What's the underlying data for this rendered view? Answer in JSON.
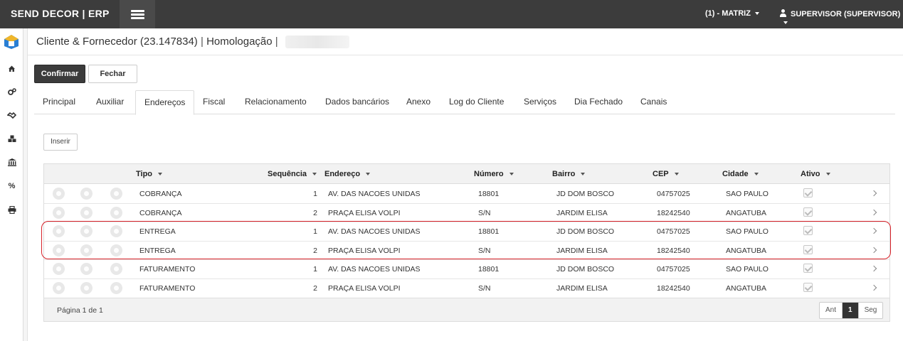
{
  "app": {
    "brand": "SEND DECOR | ERP",
    "branch": "(1) - MATRIZ",
    "user": "SUPERVISOR (SUPERVISOR)"
  },
  "colors": {
    "topbar": "#3c3c3c",
    "highlight": "#d8232a",
    "confirm_button": "#3b3b3b"
  },
  "sidebar": {
    "icons": [
      "home-icon",
      "cogs-icon",
      "handshake-icon",
      "cubes-icon",
      "bank-icon",
      "percent-icon",
      "print-icon"
    ]
  },
  "page": {
    "title": "Cliente & Fornecedor (23.147834)",
    "sep1": "|",
    "env": "Homologação",
    "sep2": "|"
  },
  "actions": {
    "confirm": "Confirmar",
    "close": "Fechar",
    "insert": "Inserir"
  },
  "tabs": [
    "Principal",
    "Auxiliar",
    "Endereços",
    "Fiscal",
    "Relacionamento",
    "Dados bancários",
    "Anexo",
    "Log do Cliente",
    "Serviços",
    "Dia Fechado",
    "Canais"
  ],
  "active_tab": "Endereços",
  "table": {
    "columns": {
      "tipo": "Tipo",
      "sequencia": "Sequência",
      "endereco": "Endereço",
      "numero": "Número",
      "bairro": "Bairro",
      "cep": "CEP",
      "cidade": "Cidade",
      "ativo": "Ativo"
    },
    "rows": [
      {
        "tipo": "COBRANÇA",
        "sequencia": "1",
        "endereco": "AV. DAS NACOES UNIDAS",
        "numero": "18801",
        "bairro": "JD DOM BOSCO",
        "cep": "04757025",
        "cidade": "SAO PAULO",
        "ativo": true
      },
      {
        "tipo": "COBRANÇA",
        "sequencia": "2",
        "endereco": "PRAÇA ELISA VOLPI",
        "numero": "S/N",
        "bairro": "JARDIM ELISA",
        "cep": "18242540",
        "cidade": "ANGATUBA",
        "ativo": true
      },
      {
        "tipo": "ENTREGA",
        "sequencia": "1",
        "endereco": "AV. DAS NACOES UNIDAS",
        "numero": "18801",
        "bairro": "JD DOM BOSCO",
        "cep": "04757025",
        "cidade": "SAO PAULO",
        "ativo": true
      },
      {
        "tipo": "ENTREGA",
        "sequencia": "2",
        "endereco": "PRAÇA ELISA VOLPI",
        "numero": "S/N",
        "bairro": "JARDIM ELISA",
        "cep": "18242540",
        "cidade": "ANGATUBA",
        "ativo": true
      },
      {
        "tipo": "FATURAMENTO",
        "sequencia": "1",
        "endereco": "AV. DAS NACOES UNIDAS",
        "numero": "18801",
        "bairro": "JD DOM BOSCO",
        "cep": "04757025",
        "cidade": "SAO PAULO",
        "ativo": true
      },
      {
        "tipo": "FATURAMENTO",
        "sequencia": "2",
        "endereco": "PRAÇA ELISA VOLPI",
        "numero": "S/N",
        "bairro": "JARDIM ELISA",
        "cep": "18242540",
        "cidade": "ANGATUBA",
        "ativo": true
      }
    ],
    "row_icons": [
      "search-icon",
      "edit-icon",
      "delete-icon"
    ]
  },
  "pagination": {
    "info": "Página 1 de 1",
    "prev": "Ant",
    "current": "1",
    "next": "Seg"
  }
}
